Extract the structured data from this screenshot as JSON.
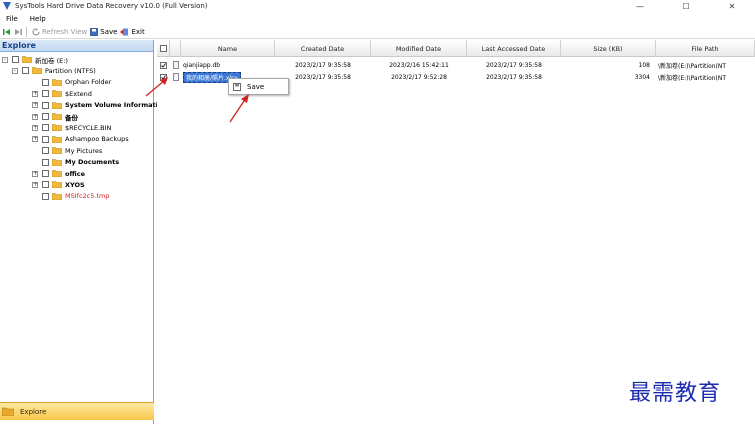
{
  "window": {
    "title": "SysTools Hard Drive Data Recovery v10.0 (Full Version)",
    "minimize": "—",
    "maximize": "☐",
    "close": "✕"
  },
  "menu": {
    "file": "File",
    "help": "Help"
  },
  "toolbar": {
    "refresh_label": "Refresh View",
    "save_label": "Save",
    "exit_label": "Exit"
  },
  "explore": {
    "header": "Explore",
    "tab_label": "Explore",
    "tree": [
      {
        "label": "新加卷 (E:)",
        "expander": "-",
        "level": 0,
        "style": "normal"
      },
      {
        "label": "Partition (NTFS)",
        "expander": "-",
        "level": 1,
        "style": "normal"
      },
      {
        "label": "Orphan Folder",
        "expander": "",
        "level": 2,
        "style": "normal"
      },
      {
        "label": "$Extend",
        "expander": "+",
        "level": 2,
        "style": "normal"
      },
      {
        "label": "System Volume Information",
        "expander": "+",
        "level": 2,
        "style": "bold"
      },
      {
        "label": "备份",
        "expander": "+",
        "level": 2,
        "style": "bold"
      },
      {
        "label": "$RECYCLE.BIN",
        "expander": "+",
        "level": 2,
        "style": "normal"
      },
      {
        "label": "Ashampoo Backups",
        "expander": "+",
        "level": 2,
        "style": "normal"
      },
      {
        "label": "My Pictures",
        "expander": "",
        "level": 2,
        "style": "normal"
      },
      {
        "label": "My Documents",
        "expander": "",
        "level": 2,
        "style": "bold"
      },
      {
        "label": "office",
        "expander": "+",
        "level": 2,
        "style": "bold"
      },
      {
        "label": "XYOS",
        "expander": "+",
        "level": 2,
        "style": "bold"
      },
      {
        "label": "MSIfc2c5.tmp",
        "expander": "",
        "level": 2,
        "style": "red"
      }
    ]
  },
  "grid": {
    "columns": [
      "Name",
      "Created Date",
      "Modified Date",
      "Last Accessed Date",
      "Size (KB)",
      "File Path"
    ],
    "rows": [
      {
        "checked": true,
        "name": "qianjiapp.db",
        "created": "2023/2/17 9:35:58",
        "modified": "2023/2/16 15:42:11",
        "accessed": "2023/2/17 9:35:58",
        "size": "108",
        "path": "\\新加卷(E:)\\Partition(NT"
      },
      {
        "checked": true,
        "name": "我的相册/照片.xlsx",
        "created": "2023/2/17 9:35:58",
        "modified": "2023/2/17 9:52:28",
        "accessed": "2023/2/17 9:35:58",
        "size": "3304",
        "path": "\\新加卷(E:)\\Partition(NT"
      }
    ]
  },
  "context_menu": {
    "save_label": "Save"
  },
  "watermark": "最需教育",
  "colors": {
    "accent": "#3b78d6",
    "explore_header": "#15428b",
    "arrow": "#d42020",
    "watermark": "#1c2bb0"
  }
}
